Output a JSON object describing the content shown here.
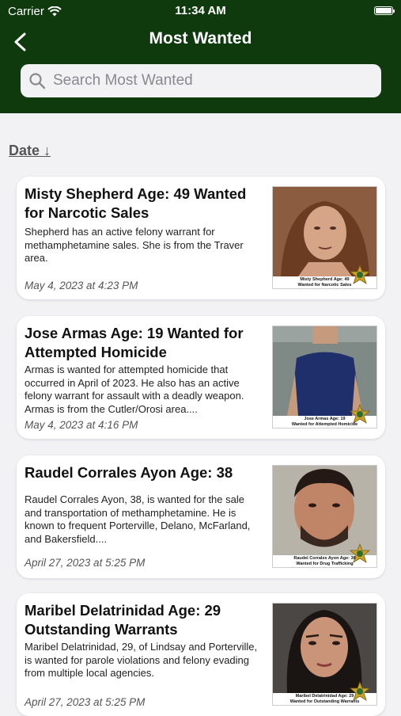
{
  "status_bar": {
    "carrier": "Carrier",
    "time": "11:34 AM"
  },
  "header": {
    "title": "Most Wanted"
  },
  "search": {
    "placeholder": "Search Most Wanted"
  },
  "sort": {
    "label": "Date ↓"
  },
  "items": [
    {
      "title": "Misty Shepherd Age: 49 Wanted for Narcotic Sales",
      "description": "Shepherd has an active felony warrant for methamphetamine sales. She is from the Traver area.",
      "date": "May 4, 2023 at 4:23 PM",
      "caption_1": "Misty Shepherd Age: 49",
      "caption_2": "Wanted for Narcotic Sales"
    },
    {
      "title": "Jose Armas Age: 19 Wanted for Attempted Homicide",
      "description": "Armas is wanted for attempted homicide that occurred in April of 2023. He also has an active felony warrant for assault with a deadly weapon. Armas is from the Cutler/Orosi area....",
      "date": "May 4, 2023 at 4:16 PM",
      "caption_1": "Jose Armas Age: 19",
      "caption_2": "Wanted for Attempted Homicide"
    },
    {
      "title": "Raudel Corrales Ayon Age: 38",
      "description": " Raudel Corrales Ayon, 38, is wanted for the sale and transportation of methamphetamine. He is known to frequent Porterville, Delano, McFarland, and Bakersfield....",
      "date": "April 27, 2023 at 5:25 PM",
      "caption_1": "Raudel Corrales Ayon Age: 38",
      "caption_2": "Wanted for Drug Trafficking"
    },
    {
      "title": "Maribel Delatrinidad Age: 29 Outstanding Warrants",
      "description": " Maribel Delatrinidad, 29, of Lindsay and Porterville, is wanted for parole violations and felony evading from multiple local agencies.",
      "date": "April 27, 2023 at 5:25 PM",
      "caption_1": "Maribel Delatrinidad Age: 29",
      "caption_2": "Wanted for Outstanding Warrants"
    }
  ],
  "colors": {
    "header_bg": "#0e3a0e",
    "page_bg": "#f2f2f5",
    "badge_gold": "#c9a227"
  }
}
